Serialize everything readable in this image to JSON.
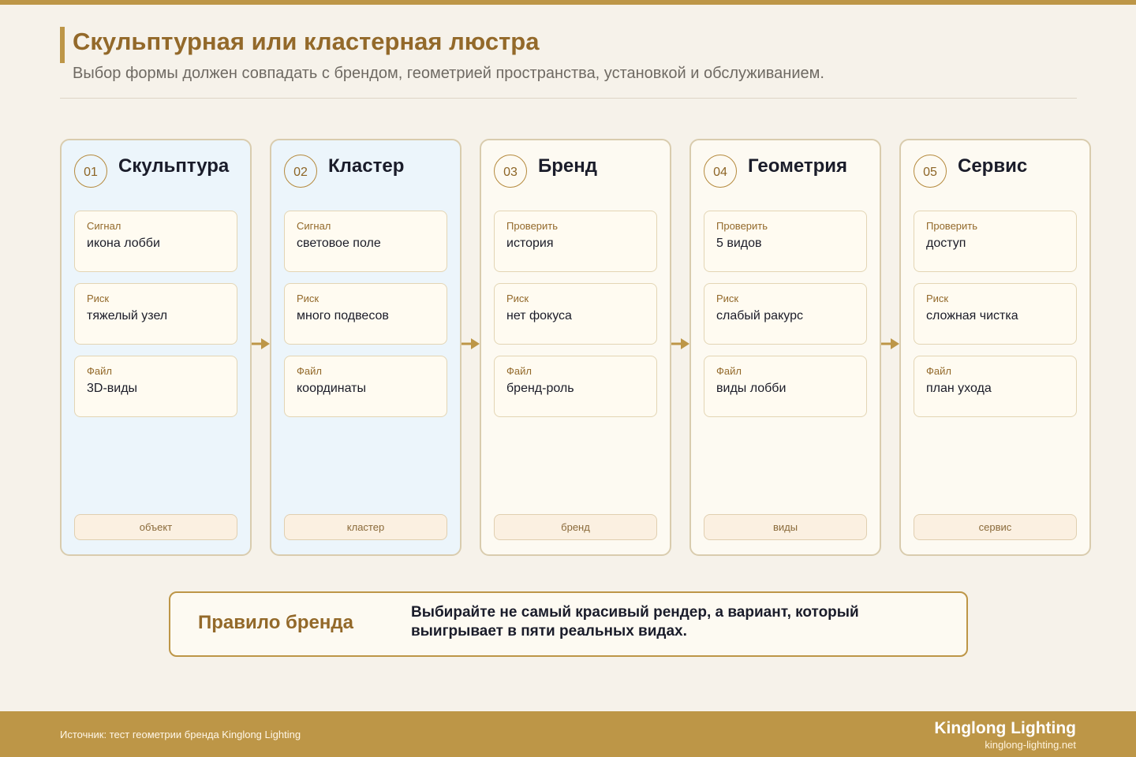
{
  "header": {
    "title": "Скульптурная или кластерная люстра",
    "subtitle": "Выбор формы должен совпадать с брендом, геометрией пространства, установкой и обслуживанием."
  },
  "steps": [
    {
      "number": "01",
      "title": "Скульптура",
      "tag": "объект",
      "fields": [
        {
          "label": "Сигнал",
          "value": "икона лобби"
        },
        {
          "label": "Риск",
          "value": "тяжелый узел"
        },
        {
          "label": "Файл",
          "value": "3D-виды"
        }
      ]
    },
    {
      "number": "02",
      "title": "Кластер",
      "tag": "кластер",
      "fields": [
        {
          "label": "Сигнал",
          "value": "световое поле"
        },
        {
          "label": "Риск",
          "value": "много подвесов"
        },
        {
          "label": "Файл",
          "value": "координаты"
        }
      ]
    },
    {
      "number": "03",
      "title": "Бренд",
      "tag": "бренд",
      "fields": [
        {
          "label": "Проверить",
          "value": "история"
        },
        {
          "label": "Риск",
          "value": "нет фокуса"
        },
        {
          "label": "Файл",
          "value": "бренд-роль"
        }
      ]
    },
    {
      "number": "04",
      "title": "Геометрия",
      "tag": "виды",
      "fields": [
        {
          "label": "Проверить",
          "value": "5 видов"
        },
        {
          "label": "Риск",
          "value": "слабый ракурс"
        },
        {
          "label": "Файл",
          "value": "виды лобби"
        }
      ]
    },
    {
      "number": "05",
      "title": "Сервис",
      "tag": "сервис",
      "fields": [
        {
          "label": "Проверить",
          "value": "доступ"
        },
        {
          "label": "Риск",
          "value": "сложная чистка"
        },
        {
          "label": "Файл",
          "value": "план ухода"
        }
      ]
    }
  ],
  "rule": {
    "label": "Правило бренда",
    "text": "Выбирайте не самый красивый рендер, а вариант, который выигрывает в пяти реальных видах."
  },
  "footer": {
    "source": "Источник: тест геометрии бренда Kinglong Lighting",
    "brand": "Kinglong Lighting",
    "site": "kinglong-lighting.net"
  },
  "colors": {
    "accent": "#bd9647",
    "title": "#93692a",
    "card_blue": "#ecf5fb",
    "card_cream": "#fdfaf2"
  }
}
